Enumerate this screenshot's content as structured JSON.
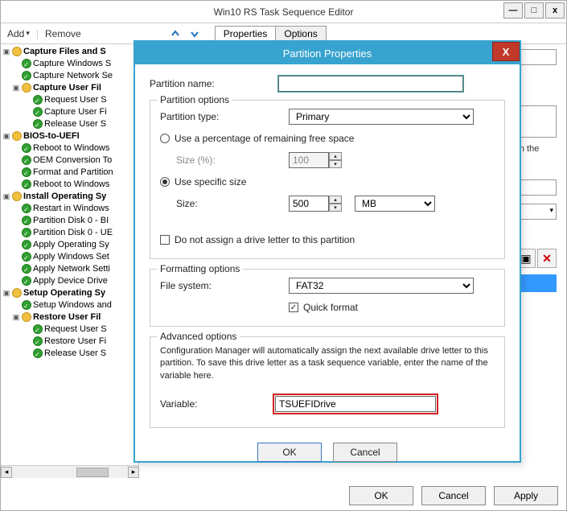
{
  "window": {
    "title": "Win10 RS Task Sequence Editor",
    "min_icon": "—",
    "max_icon": "□",
    "close_icon": "x"
  },
  "toolbar": {
    "add": "Add",
    "remove": "Remove",
    "tab_properties": "Properties",
    "tab_options": "Options"
  },
  "tree": [
    {
      "lvl": 0,
      "type": "folder",
      "bold": true,
      "label": "Capture Files and S"
    },
    {
      "lvl": 1,
      "type": "check",
      "label": "Capture Windows S"
    },
    {
      "lvl": 1,
      "type": "check",
      "label": "Capture Network Se"
    },
    {
      "lvl": 1,
      "type": "folder",
      "bold": true,
      "label": "Capture User Fil"
    },
    {
      "lvl": 2,
      "type": "check",
      "label": "Request User S"
    },
    {
      "lvl": 2,
      "type": "check",
      "label": "Capture User Fi"
    },
    {
      "lvl": 2,
      "type": "check",
      "label": "Release User S"
    },
    {
      "lvl": 0,
      "type": "folder",
      "bold": true,
      "label": "BIOS-to-UEFI"
    },
    {
      "lvl": 1,
      "type": "check",
      "label": "Reboot to Windows"
    },
    {
      "lvl": 1,
      "type": "check",
      "label": "OEM Conversion To"
    },
    {
      "lvl": 1,
      "type": "check",
      "label": "Format and Partition"
    },
    {
      "lvl": 1,
      "type": "check",
      "label": "Reboot to Windows"
    },
    {
      "lvl": 0,
      "type": "folder",
      "bold": true,
      "label": "Install Operating Sy"
    },
    {
      "lvl": 1,
      "type": "check",
      "label": "Restart in Windows"
    },
    {
      "lvl": 1,
      "type": "check",
      "label": "Partition Disk 0 - BI"
    },
    {
      "lvl": 1,
      "type": "check",
      "label": "Partition Disk 0 - UE"
    },
    {
      "lvl": 1,
      "type": "check",
      "label": "Apply Operating Sy"
    },
    {
      "lvl": 1,
      "type": "check",
      "label": "Apply Windows Set"
    },
    {
      "lvl": 1,
      "type": "check",
      "label": "Apply Network Setti"
    },
    {
      "lvl": 1,
      "type": "check",
      "label": "Apply Device Drive"
    },
    {
      "lvl": 0,
      "type": "folder",
      "bold": true,
      "label": "Setup Operating Sy"
    },
    {
      "lvl": 1,
      "type": "check",
      "label": "Setup Windows and"
    },
    {
      "lvl": 1,
      "type": "folder",
      "bold": true,
      "label": "Restore User Fil"
    },
    {
      "lvl": 2,
      "type": "check",
      "label": "Request User S"
    },
    {
      "lvl": 2,
      "type": "check",
      "label": "Restore User Fi"
    },
    {
      "lvl": 2,
      "type": "check",
      "label": "Release User S"
    }
  ],
  "rightpane": {
    "layout_text": "layout to use in the"
  },
  "dialog": {
    "title": "Partition Properties",
    "close": "X",
    "name_label": "Partition name:",
    "name_value": "",
    "options_group": "Partition options",
    "type_label": "Partition type:",
    "type_value": "Primary",
    "radio_pct": "Use a percentage of remaining free space",
    "size_pct_label": "Size (%):",
    "size_pct_value": "100",
    "radio_size": "Use specific size",
    "size_label": "Size:",
    "size_value": "500",
    "size_unit": "MB",
    "no_letter": "Do not assign a drive letter to this partition",
    "format_group": "Formatting options",
    "fs_label": "File system:",
    "fs_value": "FAT32",
    "quick_format": "Quick format",
    "adv_group": "Advanced options",
    "adv_text": "Configuration Manager will automatically assign the next available drive letter to this partition. To save this drive letter as a task sequence variable, enter the name of the variable here.",
    "var_label": "Variable:",
    "var_value": "TSUEFIDrive",
    "ok": "OK",
    "cancel": "Cancel"
  },
  "footer": {
    "ok": "OK",
    "cancel": "Cancel",
    "apply": "Apply"
  }
}
